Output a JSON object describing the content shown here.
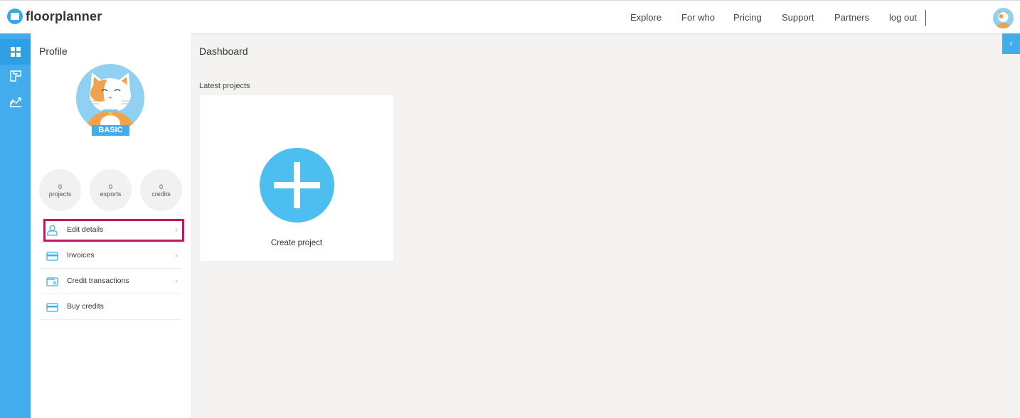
{
  "app": {
    "name": "floorplanner"
  },
  "nav": {
    "items": [
      "Explore",
      "For who",
      "Pricing",
      "Support",
      "Partners",
      "log out"
    ]
  },
  "profile": {
    "title": "Profile",
    "plan_badge": "BASIC",
    "stats": [
      {
        "value": "0",
        "label": "projects"
      },
      {
        "value": "0",
        "label": "exports"
      },
      {
        "value": "0",
        "label": "credits"
      }
    ],
    "menu": [
      {
        "label": "Edit details",
        "icon": "user-icon",
        "chevron": true,
        "highlighted": true
      },
      {
        "label": "Invoices",
        "icon": "card-icon",
        "chevron": true
      },
      {
        "label": "Credit transactions",
        "icon": "wallet-icon",
        "chevron": true
      },
      {
        "label": "Buy credits",
        "icon": "card-icon",
        "chevron": false
      }
    ]
  },
  "main": {
    "title": "Dashboard",
    "section_label": "Latest projects",
    "create_label": "Create project"
  },
  "colors": {
    "accent": "#43acec",
    "highlight": "#c4175f",
    "plus_circle": "#4cbef0"
  }
}
